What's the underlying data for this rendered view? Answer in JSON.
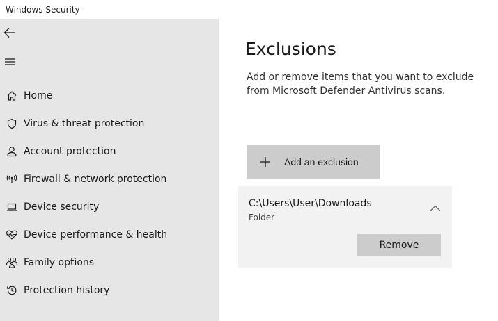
{
  "window": {
    "title": "Windows Security"
  },
  "sidebar": {
    "back_icon": "back-arrow-icon",
    "menu_icon": "hamburger-menu-icon",
    "items": [
      {
        "label": "Home",
        "icon": "home-icon"
      },
      {
        "label": "Virus & threat protection",
        "icon": "shield-icon"
      },
      {
        "label": "Account protection",
        "icon": "person-icon"
      },
      {
        "label": "Firewall & network protection",
        "icon": "wireless-signal-icon"
      },
      {
        "label": "Device security",
        "icon": "laptop-icon"
      },
      {
        "label": "Device performance & health",
        "icon": "heart-pulse-icon"
      },
      {
        "label": "Family options",
        "icon": "family-icon"
      },
      {
        "label": "Protection history",
        "icon": "history-icon"
      }
    ]
  },
  "main": {
    "title": "Exclusions",
    "description": "Add or remove items that you want to exclude from Microsoft Defender Antivirus scans.",
    "add_button_label": "Add an exclusion",
    "exclusions": [
      {
        "path": "C:\\Users\\User\\Downloads",
        "type": "Folder",
        "remove_label": "Remove",
        "expanded": true
      }
    ]
  },
  "colors": {
    "sidebar_bg": "#e6e6e6",
    "button_bg": "#cccccc",
    "card_bg": "#f2f2f2",
    "text": "#1a1a1a"
  }
}
